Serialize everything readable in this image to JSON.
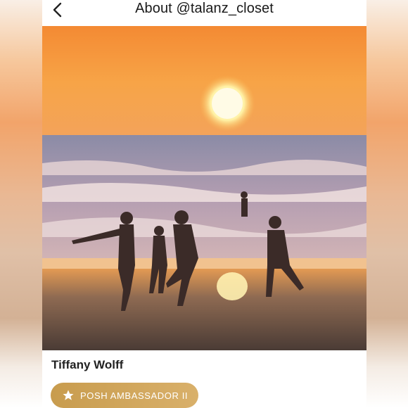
{
  "header": {
    "title": "About @talanz_closet",
    "back_icon": "chevron-left-icon"
  },
  "profile": {
    "name": "Tiffany Wolff",
    "badge": {
      "label": "POSH AMBASSADOR II",
      "icon": "star-icon",
      "color": "#cfa45a"
    }
  },
  "colors": {
    "accent": "#cfa45a",
    "text": "#222222"
  }
}
